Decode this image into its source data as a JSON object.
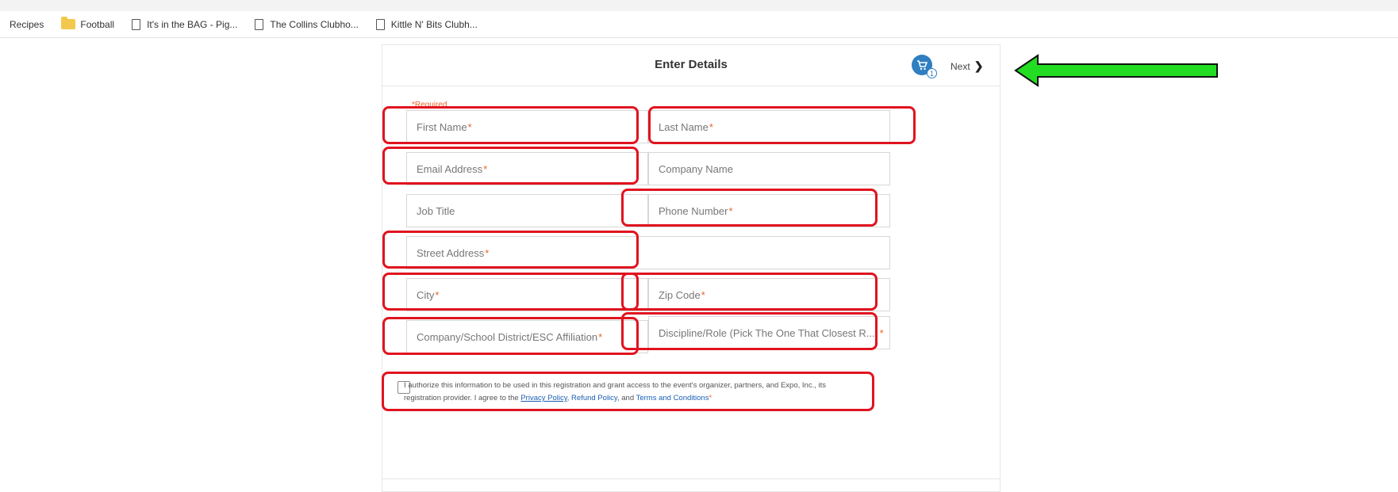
{
  "bookmarks": [
    {
      "label": "Recipes",
      "icon": "none"
    },
    {
      "label": "Football",
      "icon": "folder-icon"
    },
    {
      "label": "It's in the BAG - Pig...",
      "icon": "page-icon"
    },
    {
      "label": "The Collins Clubho...",
      "icon": "page-icon"
    },
    {
      "label": "Kittle N' Bits Clubh...",
      "icon": "page-icon"
    }
  ],
  "header": {
    "title": "Enter Details",
    "cart_count": "1",
    "next_label": "Next"
  },
  "form": {
    "required_note": "*Required",
    "first_name": "First Name",
    "last_name": "Last Name",
    "email": "Email Address",
    "company": "Company Name",
    "job_title": "Job Title",
    "phone": "Phone Number",
    "street": "Street Address",
    "city": "City",
    "zip": "Zip Code",
    "affiliation": "Company/School District/ESC Affiliation",
    "discipline": "Discipline/Role (Pick The One That Closest R...",
    "star": "*"
  },
  "consent": {
    "line1": "I authorize this information to be used in this registration and grant access to the event's organizer, partners, and Expo, Inc., its",
    "line2_prefix": "registration provider. I agree to the",
    "privacy": "Privacy Policy",
    "sep1": ",",
    "refund": "Refund Policy",
    "and": ", and",
    "terms": "Terms and Conditions",
    "star": "*"
  },
  "colors": {
    "highlight": "#e0141f",
    "arrow": "#22dd22",
    "accent": "#2f7fc1",
    "required": "#e8662f"
  }
}
